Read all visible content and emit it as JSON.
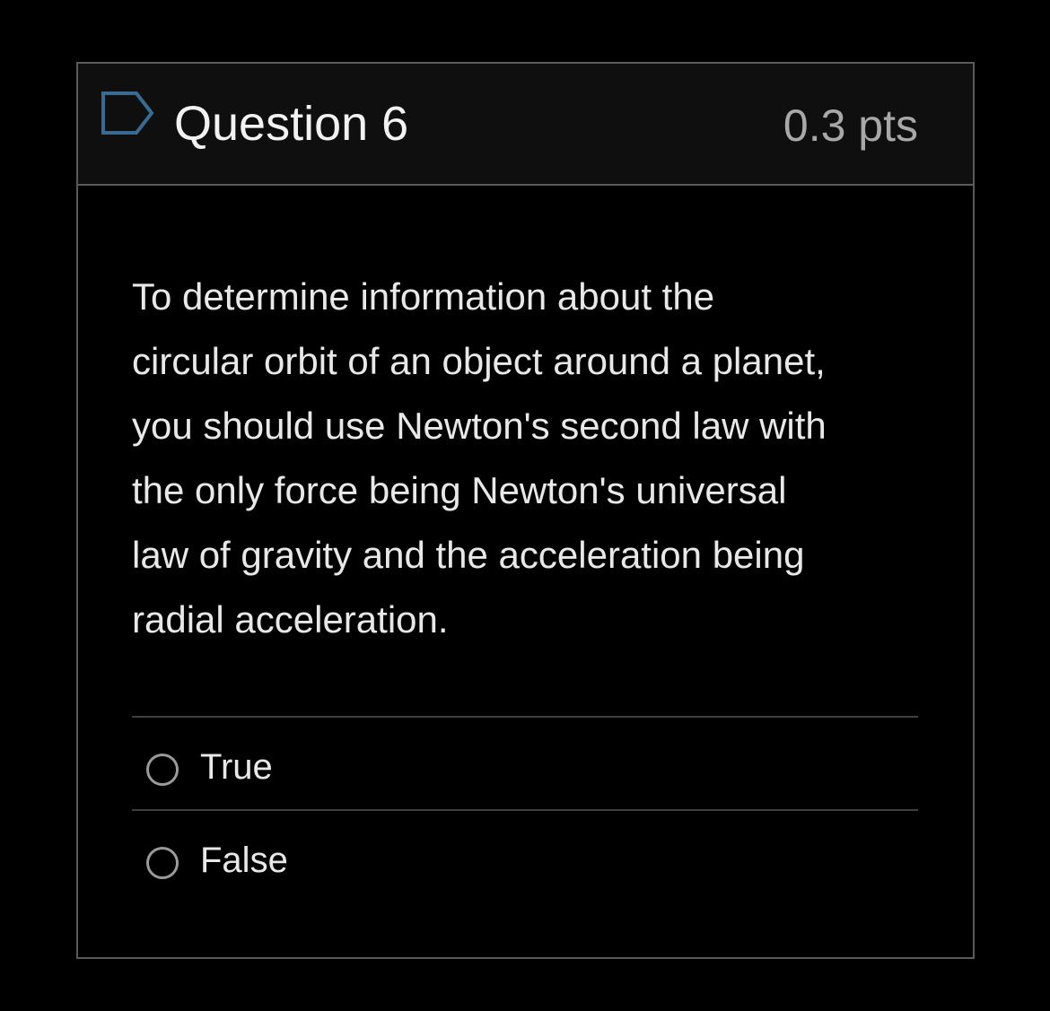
{
  "question": {
    "title": "Question 6",
    "points": "0.3 pts",
    "text": "To determine information about the\ncircular orbit of an object around a planet,\nyou should use Newton's second law with\nthe only force being Newton's universal\nlaw of gravity and the acceleration being\nradial acceleration.",
    "flag_icon": "flag-question-icon",
    "answers": [
      {
        "label": "True",
        "selected": false
      },
      {
        "label": "False",
        "selected": false
      }
    ]
  },
  "colors": {
    "background": "#000000",
    "header_background": "#0f0f0f",
    "border": "#5a5a5a",
    "flag_icon": "#3a6a8f",
    "title_text": "#f2f2f2",
    "points_text": "#a8a8a8",
    "body_text": "#e8e8e8",
    "radio_border": "#9a9a9a"
  }
}
